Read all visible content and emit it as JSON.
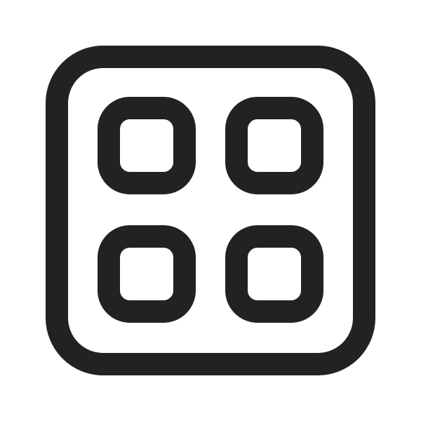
{
  "icon": {
    "name": "grid-apps-icon",
    "stroke_color": "#222222",
    "background_color": "#ffffff"
  }
}
